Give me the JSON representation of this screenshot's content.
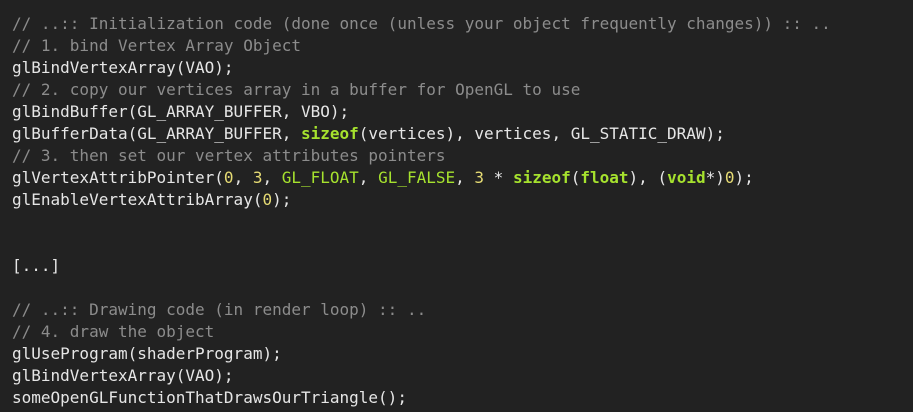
{
  "editor": {
    "colors": {
      "background": "#222222",
      "text": "#e6e6e6",
      "comment": "#8c8c8c",
      "keyword": "#a6e22e",
      "number": "#e6db74"
    },
    "lines": [
      [
        {
          "t": "comment",
          "v": "// ..:: Initialization code (done once (unless your object frequently changes)) :: .."
        }
      ],
      [
        {
          "t": "comment",
          "v": "// 1. bind Vertex Array Object"
        }
      ],
      [
        {
          "t": "plain",
          "v": "glBindVertexArray(VAO);"
        }
      ],
      [
        {
          "t": "comment",
          "v": "// 2. copy our vertices array in a buffer for OpenGL to use"
        }
      ],
      [
        {
          "t": "plain",
          "v": "glBindBuffer(GL_ARRAY_BUFFER, VBO);"
        }
      ],
      [
        {
          "t": "plain",
          "v": "glBufferData(GL_ARRAY_BUFFER, "
        },
        {
          "t": "keyword",
          "v": "sizeof"
        },
        {
          "t": "plain",
          "v": "(vertices), vertices, GL_STATIC_DRAW);"
        }
      ],
      [
        {
          "t": "comment",
          "v": "// 3. then set our vertex attributes pointers"
        }
      ],
      [
        {
          "t": "plain",
          "v": "glVertexAttribPointer("
        },
        {
          "t": "number",
          "v": "0"
        },
        {
          "t": "plain",
          "v": ", "
        },
        {
          "t": "number",
          "v": "3"
        },
        {
          "t": "plain",
          "v": ", "
        },
        {
          "t": "const",
          "v": "GL_FLOAT"
        },
        {
          "t": "plain",
          "v": ", "
        },
        {
          "t": "const",
          "v": "GL_FALSE"
        },
        {
          "t": "plain",
          "v": ", "
        },
        {
          "t": "number",
          "v": "3"
        },
        {
          "t": "plain",
          "v": " * "
        },
        {
          "t": "keyword",
          "v": "sizeof"
        },
        {
          "t": "plain",
          "v": "("
        },
        {
          "t": "keyword",
          "v": "float"
        },
        {
          "t": "plain",
          "v": "), ("
        },
        {
          "t": "keyword",
          "v": "void"
        },
        {
          "t": "plain",
          "v": "*)"
        },
        {
          "t": "number",
          "v": "0"
        },
        {
          "t": "plain",
          "v": ");"
        }
      ],
      [
        {
          "t": "plain",
          "v": "glEnableVertexAttribArray("
        },
        {
          "t": "number",
          "v": "0"
        },
        {
          "t": "plain",
          "v": ");"
        }
      ],
      [
        {
          "t": "plain",
          "v": ""
        }
      ],
      [
        {
          "t": "plain",
          "v": ""
        }
      ],
      [
        {
          "t": "plain",
          "v": "[...]"
        }
      ],
      [
        {
          "t": "plain",
          "v": ""
        }
      ],
      [
        {
          "t": "comment",
          "v": "// ..:: Drawing code (in render loop) :: .."
        }
      ],
      [
        {
          "t": "comment",
          "v": "// 4. draw the object"
        }
      ],
      [
        {
          "t": "plain",
          "v": "glUseProgram(shaderProgram);"
        }
      ],
      [
        {
          "t": "plain",
          "v": "glBindVertexArray(VAO);"
        }
      ],
      [
        {
          "t": "plain",
          "v": "someOpenGLFunctionThatDrawsOurTriangle();"
        }
      ]
    ]
  }
}
